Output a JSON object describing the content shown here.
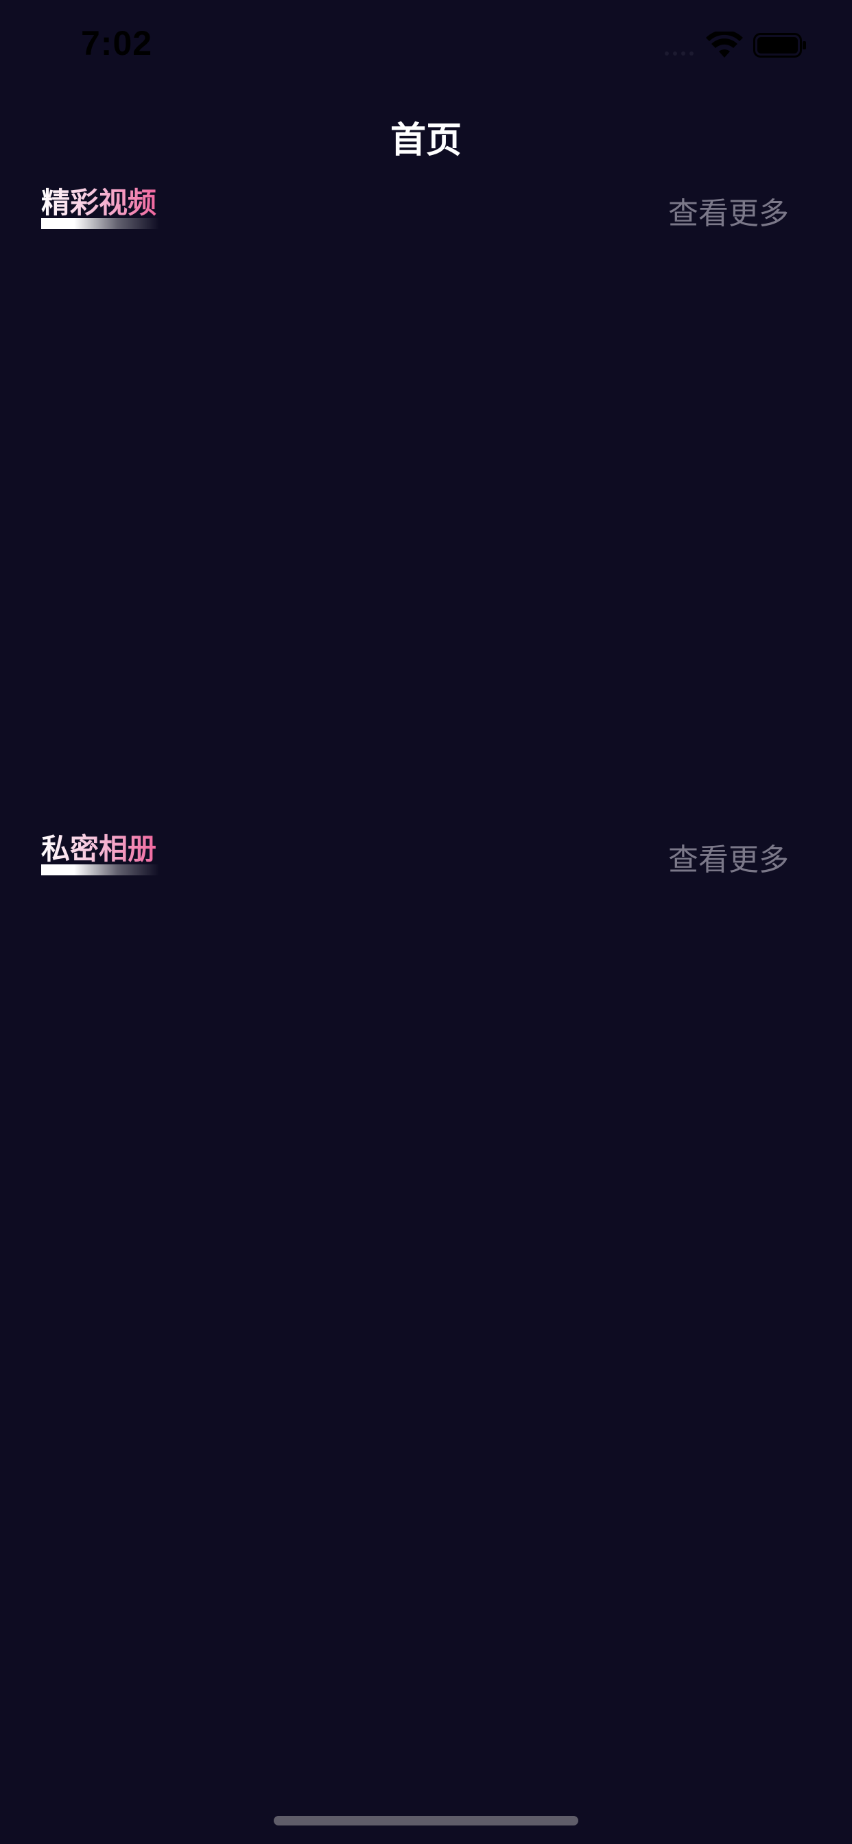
{
  "status_bar": {
    "time": "7:02"
  },
  "header": {
    "title": "首页"
  },
  "sections": [
    {
      "title": "精彩视频",
      "more_label": "查看更多"
    },
    {
      "title": "私密相册",
      "more_label": "查看更多"
    }
  ],
  "colors": {
    "background": "#0e0c22",
    "accent_pink": "#f0679e",
    "muted_text": "#7b7889"
  },
  "icons": [
    "signal-icon",
    "wifi-icon",
    "battery-icon"
  ]
}
